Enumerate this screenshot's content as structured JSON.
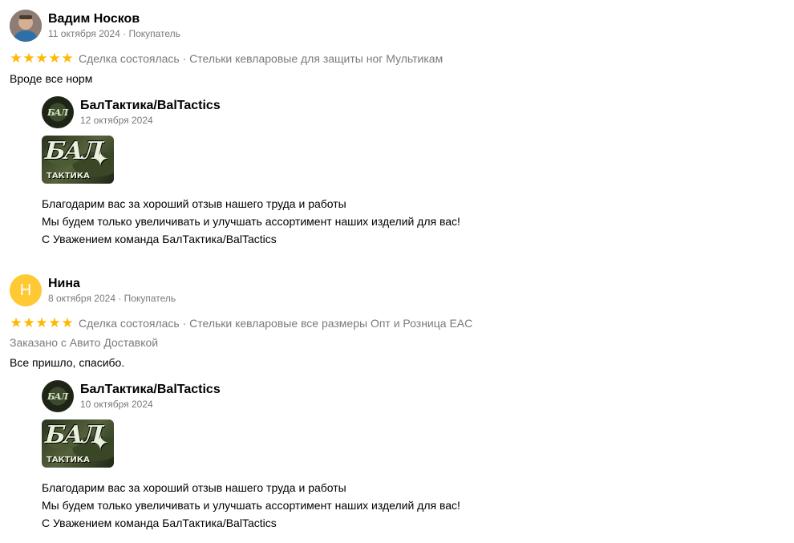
{
  "reviews": [
    {
      "author": "Вадим Носков",
      "avatar": {
        "type": "photo",
        "icon": "user-photo"
      },
      "meta": "11 октября 2024 · Покупатель",
      "stars": 5,
      "deal": "Сделка состоялась · Стельки кевларовые для защиты ног Мультикам",
      "ordered": "",
      "text": "Вроде все норм",
      "reply": {
        "seller": "БалТактика/BalTactics",
        "date": "12 октября 2024",
        "image_logo": "БАЛ",
        "image_sub": "ТАКТИКА",
        "lines": [
          "Благодарим вас за хороший отзыв нашего труда и работы",
          "Мы будем только увеличивать и улучшать ассортимент наших изделий для вас!",
          "С Уважением команда БалТактика/BalTactics"
        ]
      }
    },
    {
      "author": "Нина",
      "avatar": {
        "type": "letter",
        "letter": "Н",
        "color": "#ffc933"
      },
      "meta": "8 октября 2024 · Покупатель",
      "stars": 5,
      "deal": "Сделка состоялась · Стельки кевларовые все размеры Опт и Розница EAC",
      "ordered": "Заказано с Авито Доставкой",
      "text": "Все пришло, спасибо.",
      "reply": {
        "seller": "БалТактика/BalTactics",
        "date": "10 октября 2024",
        "image_logo": "БАЛ",
        "image_sub": "ТАКТИКА",
        "lines": [
          "Благодарим вас за хороший отзыв нашего труда и работы",
          "Мы будем только увеличивать и улучшать ассортимент наших изделий для вас!",
          "С Уважением команда БалТактика/BalTactics"
        ]
      }
    }
  ],
  "colors": {
    "star": "#ffb800",
    "muted_text": "#7a7a7a",
    "letter_avatar": "#ffc933"
  }
}
